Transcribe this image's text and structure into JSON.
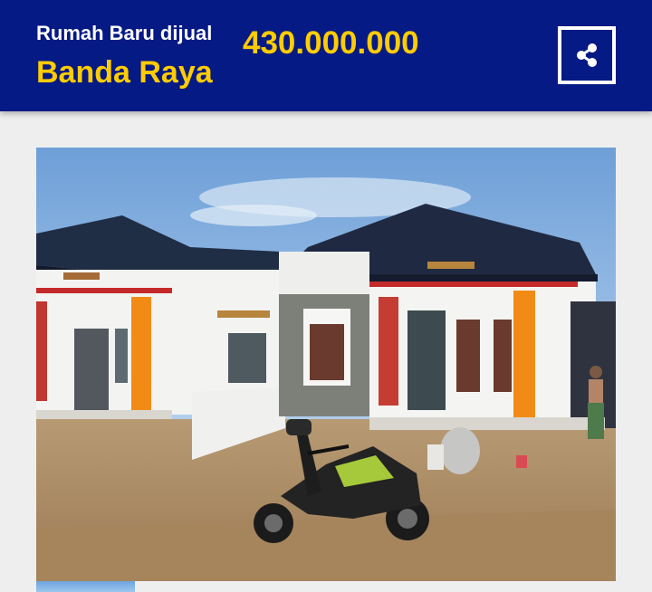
{
  "header": {
    "subtitle": "Rumah Baru dijual",
    "title": "Banda Raya",
    "price": "430.000.000",
    "share_icon": "share-icon"
  },
  "colors": {
    "header_bg": "#061a85",
    "accent": "#ffcc00",
    "page_bg": "#eeeeee"
  },
  "gallery": {
    "main_photo": "house-photo",
    "thumbnail": "thumbnail-photo"
  }
}
